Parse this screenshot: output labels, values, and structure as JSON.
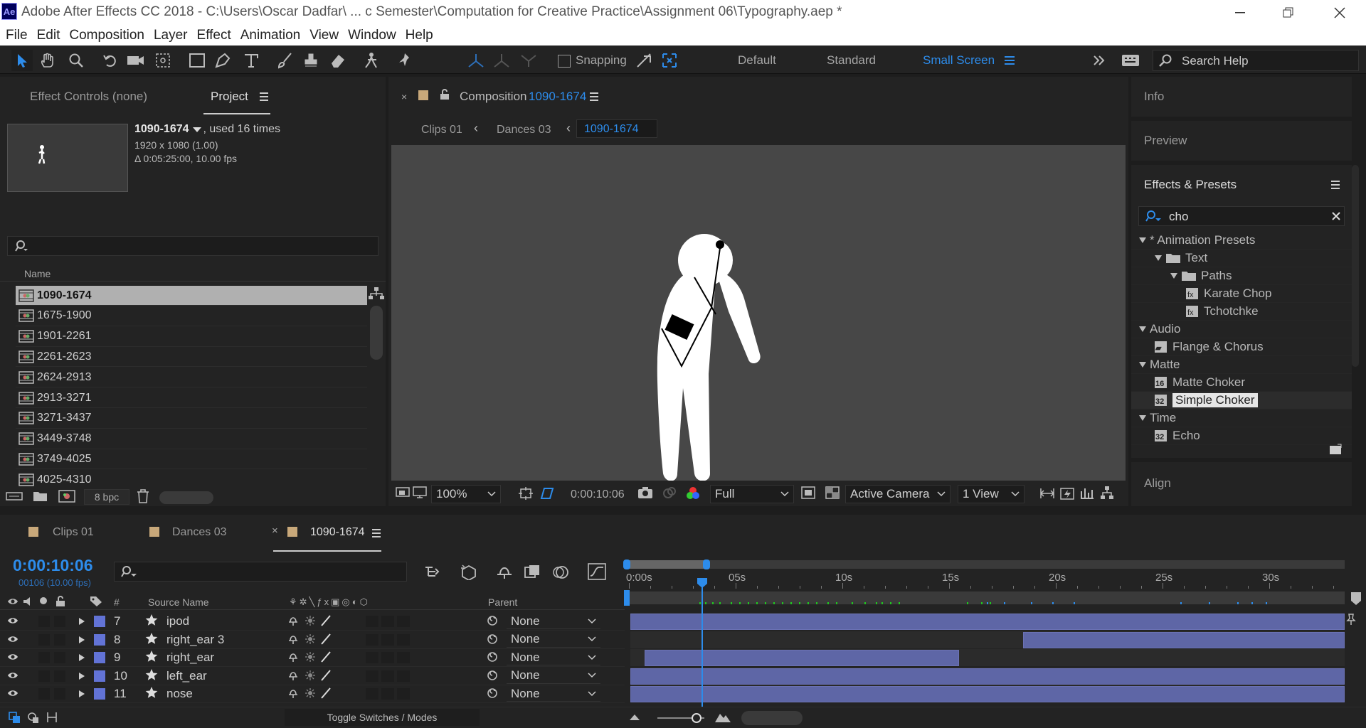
{
  "app": {
    "logo": "Ae",
    "title": "Adobe After Effects CC 2018 - C:\\Users\\Oscar Dadfar\\ ... c Semester\\Computation for Creative Practice\\Assignment 06\\Typography.aep *"
  },
  "menu": [
    "File",
    "Edit",
    "Composition",
    "Layer",
    "Effect",
    "Animation",
    "View",
    "Window",
    "Help"
  ],
  "toolbar": {
    "snapping": "Snapping",
    "workspaces": [
      "Default",
      "Standard",
      "Small Screen"
    ],
    "search_placeholder": "Search Help",
    "accent": "#2d8ceb"
  },
  "project": {
    "tabs": {
      "effect_controls": "Effect Controls (none)",
      "project": "Project"
    },
    "item_name": "1090-1674",
    "used": ", used 16 times",
    "dims": "1920 x 1080 (1.00)",
    "duration": "Δ 0:05:25:00, 10.00 fps",
    "col_name": "Name",
    "items": [
      "1090-1674",
      "1675-1900",
      "1901-2261",
      "2261-2623",
      "2624-2913",
      "2913-3271",
      "3271-3437",
      "3449-3748",
      "3749-4025",
      "4025-4310"
    ],
    "bpc": "8 bpc"
  },
  "comp": {
    "label": "Composition",
    "name": "1090-1674",
    "breadcrumbs": [
      "Clips 01",
      "Dances 03",
      "1090-1674"
    ],
    "zoom": "100%",
    "time": "0:00:10:06",
    "resolution": "Full",
    "camera": "Active Camera",
    "views": "1 View"
  },
  "right": {
    "info": "Info",
    "preview": "Preview",
    "effects": "Effects & Presets",
    "search": "cho",
    "tree": [
      {
        "label": "* Animation Presets",
        "level": 0,
        "type": "arrow"
      },
      {
        "label": "Text",
        "level": 1,
        "type": "folder"
      },
      {
        "label": "Paths",
        "level": 2,
        "type": "folder"
      },
      {
        "label": "Karate Chop",
        "level": 3,
        "type": "preset"
      },
      {
        "label": "Tchotchke",
        "level": 3,
        "type": "preset"
      },
      {
        "label": "Audio",
        "level": 0,
        "type": "arrow"
      },
      {
        "label": "Flange & Chorus",
        "level": 1,
        "type": "fx"
      },
      {
        "label": "Matte",
        "level": 0,
        "type": "arrow"
      },
      {
        "label": "Matte Choker",
        "level": 1,
        "type": "fx16"
      },
      {
        "label": "Simple Choker",
        "level": 1,
        "type": "fx32"
      },
      {
        "label": "Time",
        "level": 0,
        "type": "arrow"
      },
      {
        "label": "Echo",
        "level": 1,
        "type": "fx32"
      }
    ],
    "align": "Align"
  },
  "timeline": {
    "tabs": [
      "Clips 01",
      "Dances 03",
      "1090-1674"
    ],
    "timecode": "0:00:10:06",
    "frames": "00106 (10.00 fps)",
    "col_num": "#",
    "col_source": "Source Name",
    "col_parent": "Parent",
    "ruler": [
      "0:00s",
      "05s",
      "10s",
      "15s",
      "20s",
      "25s",
      "30s"
    ],
    "current_fraction": 0.34,
    "layers": [
      {
        "num": "7",
        "name": "ipod",
        "parent": "None",
        "bar": [
          0,
          1
        ]
      },
      {
        "num": "8",
        "name": "right_ear 3",
        "parent": "None",
        "bar": [
          0.55,
          1
        ]
      },
      {
        "num": "9",
        "name": "right_ear",
        "parent": "None",
        "bar": [
          0.02,
          0.46
        ]
      },
      {
        "num": "10",
        "name": "left_ear",
        "parent": "None",
        "bar": [
          0,
          1
        ]
      },
      {
        "num": "11",
        "name": "nose",
        "parent": "None",
        "bar": [
          0,
          1
        ]
      }
    ],
    "toggle": "Toggle Switches / Modes"
  }
}
